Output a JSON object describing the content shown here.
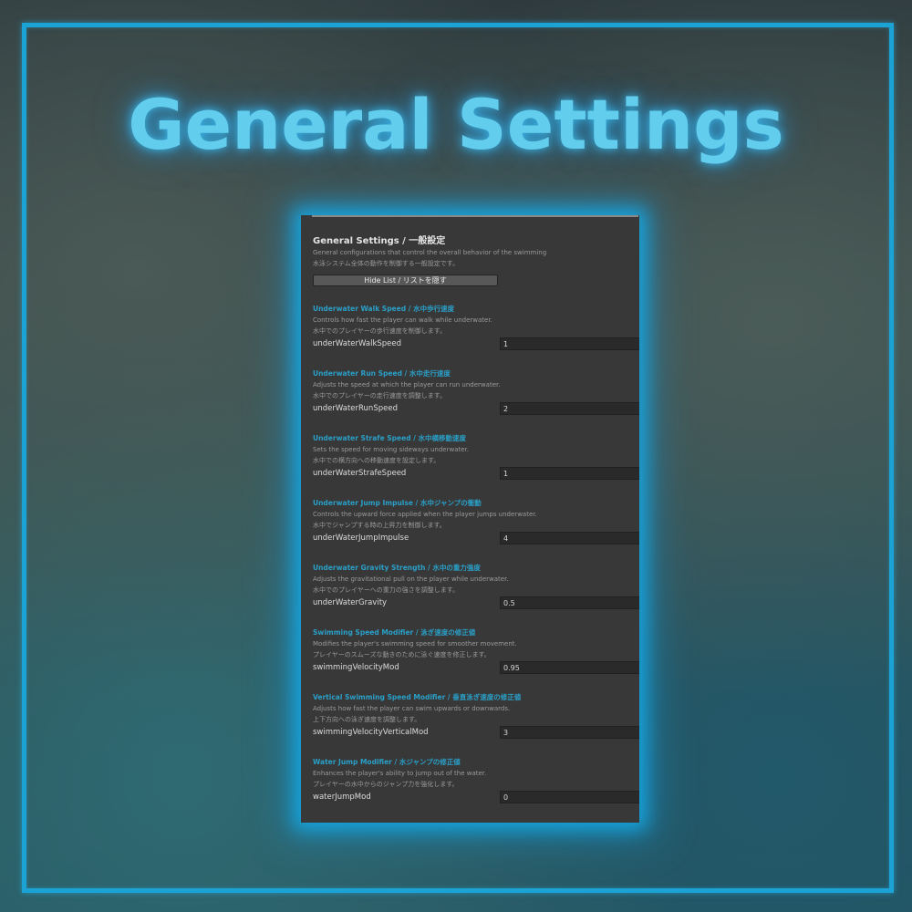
{
  "hero": {
    "title": "General Settings"
  },
  "panel": {
    "heading": "General Settings / 一般設定",
    "desc_en": "General configurations that control the overall behavior of the swimming",
    "desc_ja": "水泳システム全体の動作を制御する一般設定です。",
    "hide_button": "Hide List / リストを隠す",
    "sections": [
      {
        "title": "Underwater Walk Speed / 水中歩行速度",
        "desc_en": "Controls how fast the player can walk while underwater.",
        "desc_ja": "水中でのプレイヤーの歩行速度を制御します。",
        "prop": "underWaterWalkSpeed",
        "value": "1"
      },
      {
        "title": "Underwater Run Speed / 水中走行速度",
        "desc_en": "Adjusts the speed at which the player can run underwater.",
        "desc_ja": "水中でのプレイヤーの走行速度を調整します。",
        "prop": "underWaterRunSpeed",
        "value": "2"
      },
      {
        "title": "Underwater Strafe Speed / 水中横移動速度",
        "desc_en": "Sets the speed for moving sideways underwater.",
        "desc_ja": "水中での横方向への移動速度を設定します。",
        "prop": "underWaterStrafeSpeed",
        "value": "1"
      },
      {
        "title": "Underwater Jump Impulse / 水中ジャンプの衝動",
        "desc_en": "Controls the upward force applied when the player jumps underwater.",
        "desc_ja": "水中でジャンプする時の上昇力を制御します。",
        "prop": "underWaterJumpImpulse",
        "value": "4"
      },
      {
        "title": "Underwater Gravity Strength / 水中の重力強度",
        "desc_en": "Adjusts the gravitational pull on the player while underwater.",
        "desc_ja": "水中でのプレイヤーへの重力の強さを調整します。",
        "prop": "underWaterGravity",
        "value": "0.5"
      },
      {
        "title": "Swimming Speed Modifier / 泳ぎ速度の修正値",
        "desc_en": "Modifies the player's swimming speed for smoother movement.",
        "desc_ja": "プレイヤーのスムーズな動きのために泳ぐ速度を修正します。",
        "prop": "swimmingVelocityMod",
        "value": "0.95"
      },
      {
        "title": "Vertical Swimming Speed Modifier / 垂直泳ぎ速度の修正値",
        "desc_en": "Adjusts how fast the player can swim upwards or downwards.",
        "desc_ja": "上下方向への泳ぎ速度を調整します。",
        "prop": "swimmingVelocityVerticalMod",
        "value": "3"
      },
      {
        "title": "Water Jump Modifier / 水ジャンプの修正値",
        "desc_en": "Enhances the player's ability to jump out of the water.",
        "desc_ja": "プレイヤーの水中からのジャンプ力を強化します。",
        "prop": "waterJumpMod",
        "value": "0"
      }
    ]
  }
}
